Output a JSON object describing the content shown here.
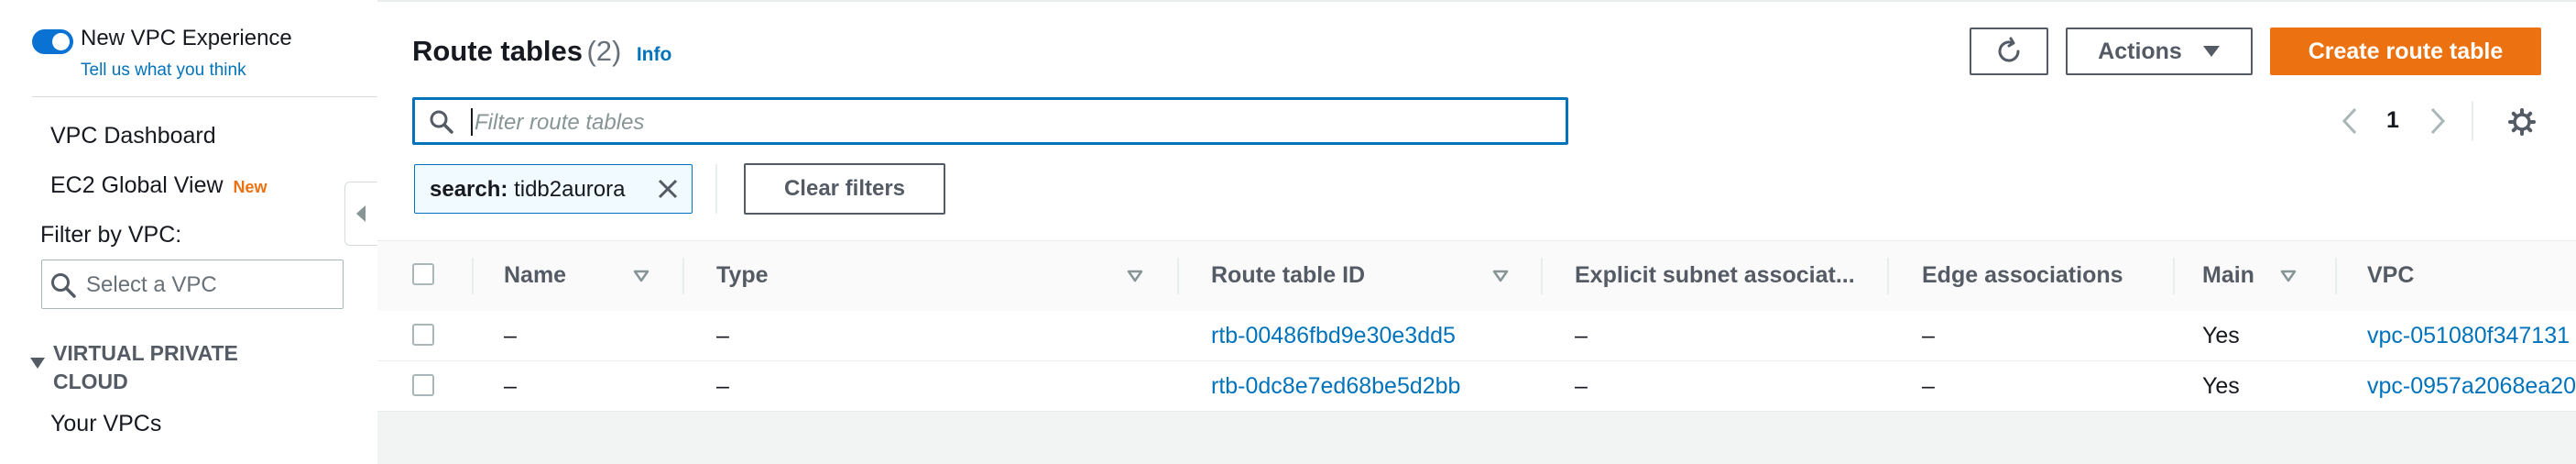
{
  "sidebar": {
    "experience_label": "New VPC Experience",
    "feedback_link": "Tell us what you think",
    "nav": {
      "dashboard": "VPC Dashboard",
      "ec2_global_view": "EC2 Global View",
      "new_badge": "New"
    },
    "filter_label": "Filter by VPC:",
    "vpc_select_placeholder": "Select a VPC",
    "section_title_line1": "VIRTUAL PRIVATE",
    "section_title_line2": "CLOUD",
    "section_items": [
      "Your VPCs"
    ]
  },
  "header": {
    "title": "Route tables",
    "count": "(2)",
    "info_link": "Info",
    "actions_label": "Actions",
    "create_label": "Create route table"
  },
  "search": {
    "placeholder": "Filter route tables",
    "token_key": "search:",
    "token_value": "tidb2aurora",
    "clear_label": "Clear filters"
  },
  "pagination": {
    "current_page": "1"
  },
  "table": {
    "columns": {
      "name": "Name",
      "type": "Type",
      "route_table_id": "Route table ID",
      "explicit_subnet": "Explicit subnet associat...",
      "edge": "Edge associations",
      "main": "Main",
      "vpc": "VPC"
    },
    "rows": [
      {
        "name": "–",
        "type": "–",
        "route_table_id": "rtb-00486fbd9e30e3dd5",
        "explicit_subnet": "–",
        "edge": "–",
        "main": "Yes",
        "vpc": "vpc-051080f347131"
      },
      {
        "name": "–",
        "type": "–",
        "route_table_id": "rtb-0dc8e7ed68be5d2bb",
        "explicit_subnet": "–",
        "edge": "–",
        "main": "Yes",
        "vpc": "vpc-0957a2068ea20"
      }
    ]
  },
  "colors": {
    "accent": "#0073bb",
    "primary_button": "#ec7211",
    "toggle_on": "#0972d3",
    "new_badge": "#ec7211"
  }
}
